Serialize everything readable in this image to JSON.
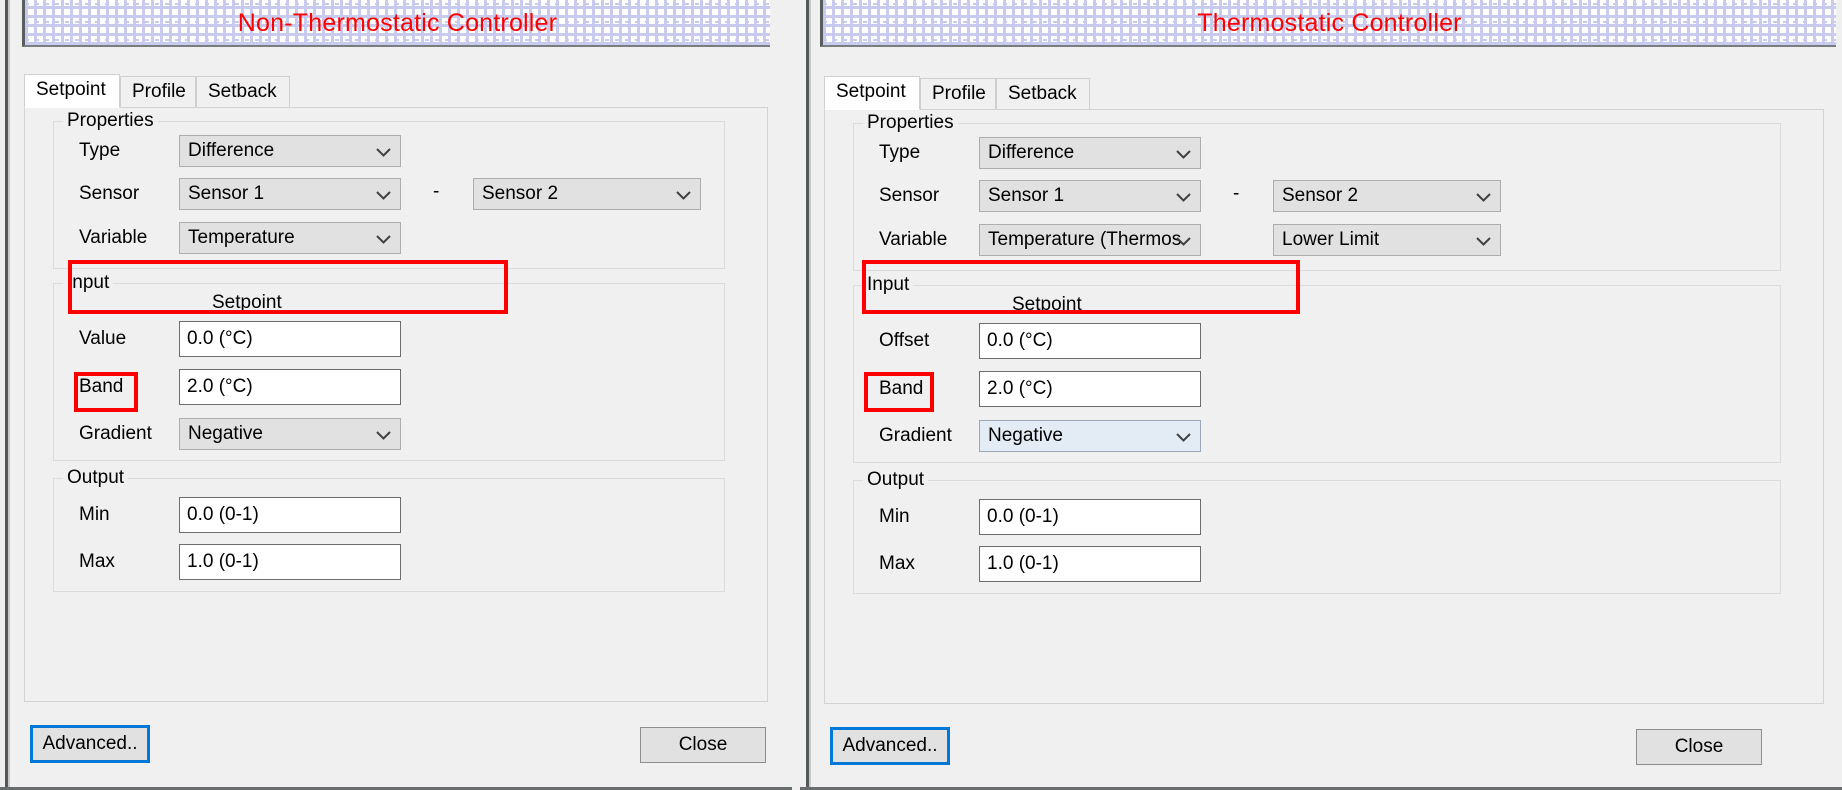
{
  "panels": [
    {
      "title": "Non-Thermostatic Controller",
      "tabs": [
        {
          "label": "Setpoint",
          "selected": true
        },
        {
          "label": "Profile",
          "selected": false
        },
        {
          "label": "Setback",
          "selected": false
        }
      ],
      "properties": {
        "group_label": "Properties",
        "type_label": "Type",
        "type_value": "Difference",
        "sensor_label": "Sensor",
        "sensor1_value": "Sensor 1",
        "operator": "-",
        "sensor2_value": "Sensor 2",
        "variable_label": "Variable",
        "variable_value": "Temperature",
        "variable2_value": ""
      },
      "input": {
        "group_label": "Input",
        "column_header": "Setpoint",
        "value_label": "Value",
        "value_value": "0.0 (°C)",
        "band_label": "Band",
        "band_value": "2.0 (°C)",
        "gradient_label": "Gradient",
        "gradient_value": "Negative"
      },
      "output": {
        "group_label": "Output",
        "min_label": "Min",
        "min_value": "0.0 (0-1)",
        "max_label": "Max",
        "max_value": "1.0 (0-1)"
      },
      "buttons": {
        "advanced_label": "Advanced..",
        "close_label": "Close"
      }
    },
    {
      "title": "Thermostatic Controller",
      "tabs": [
        {
          "label": "Setpoint",
          "selected": true
        },
        {
          "label": "Profile",
          "selected": false
        },
        {
          "label": "Setback",
          "selected": false
        }
      ],
      "properties": {
        "group_label": "Properties",
        "type_label": "Type",
        "type_value": "Difference",
        "sensor_label": "Sensor",
        "sensor1_value": "Sensor 1",
        "operator": "-",
        "sensor2_value": "Sensor 2",
        "variable_label": "Variable",
        "variable_value": "Temperature (Thermos",
        "variable2_value": "Lower Limit"
      },
      "input": {
        "group_label": "Input",
        "column_header": "Setpoint",
        "value_label": "Offset",
        "value_value": "0.0 (°C)",
        "band_label": "Band",
        "band_value": "2.0 (°C)",
        "gradient_label": "Gradient",
        "gradient_value": "Negative"
      },
      "output": {
        "group_label": "Output",
        "min_label": "Min",
        "min_value": "0.0 (0-1)",
        "max_label": "Max",
        "max_value": "1.0 (0-1)"
      },
      "buttons": {
        "advanced_label": "Advanced..",
        "close_label": "Close"
      }
    }
  ],
  "colors": {
    "annotation_red": "#ff0000",
    "title_red": "#ff0000",
    "focus_blue": "#0078d7",
    "window_bg": "#f0f0f0",
    "field_bg": "#ffffff",
    "combo_bg": "#e1e1e1",
    "grid_line": "#c9cbee"
  },
  "icons": {
    "chevron": "chevron-down-icon"
  }
}
